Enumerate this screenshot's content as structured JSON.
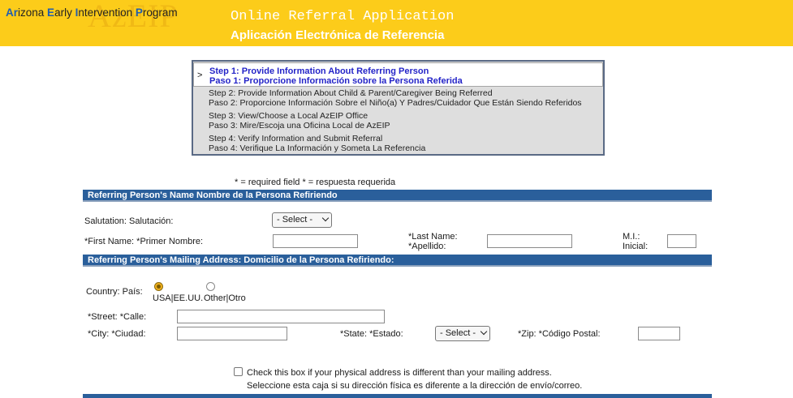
{
  "header": {
    "logo": {
      "A1": "Ar",
      "I1": "i",
      "rest1": "zona ",
      "E": "E",
      "rest2": "arly ",
      "I2": "I",
      "rest3": "ntervention ",
      "P": "P",
      "rest4": "rogram",
      "watermark": "AzEIP"
    },
    "title_en": "Online Referral Application",
    "title_es": "Aplicación  Electrónica de Referencia"
  },
  "steps": {
    "current_marker": ">",
    "current": {
      "en": "Step 1: Provide Information About Referring Person",
      "es": "Paso 1: Proporcione Información sobre la Persona Referida"
    },
    "items": [
      {
        "en": "Step 2: Provide Information About Child & Parent/Caregiver Being Referred",
        "es": "Paso 2: Proporcione Información Sobre el Niño(a) Y Padres/Cuidador Que Están Siendo Referidos"
      },
      {
        "en": "Step 3: View/Choose a Local AzEIP Office",
        "es": "Paso 3: Mire/Escoja una Oficina Local de AzEIP"
      },
      {
        "en": "Step 4: Verify Information and Submit Referral",
        "es": "Paso 4: Verifique La Información y Someta La Referencia"
      }
    ]
  },
  "required_note": "* = required field * = respuesta requerida",
  "sections": {
    "name": "Referring Person's Name  Nombre de la Persona Refiriendo",
    "address": "Referring Person's Mailing Address: Domicilio de la Persona Refiriendo:"
  },
  "fields": {
    "salutation_label": "Salutation: Salutación:",
    "salutation_value": "- Select -",
    "first_name_label": "*First Name: *Primer Nombre:",
    "last_name_label_1": "*Last Name:",
    "last_name_label_2": "*Apellido:",
    "mi_label_1": "M.I.:",
    "mi_label_2": "Inicial:",
    "country_label": "Country: País:",
    "country_usa": "USA|EE.UU.",
    "country_other": "Other|Otro",
    "street_label": "*Street: *Calle:",
    "city_label": "*City: *Ciudad:",
    "state_label": "*State: *Estado:",
    "state_value": "- Select -",
    "zip_label": "*Zip: *Código Postal:",
    "physical_check_en": "Check this box if your physical address is different than your mailing address.",
    "physical_check_es": "Seleccione esta caja si su dirección física es diferente a la dirección de envío/correo."
  },
  "colors": {
    "header": "#fccc1a",
    "section_bar": "#2a5f9b",
    "current_step_text": "#2424c8"
  }
}
